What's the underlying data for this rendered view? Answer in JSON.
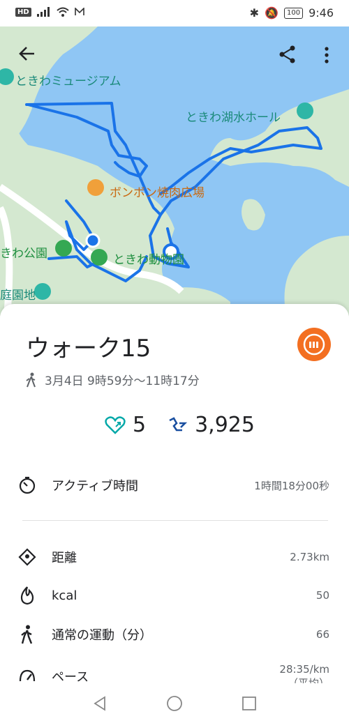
{
  "status_bar": {
    "network_badge": "HD",
    "time": "9:46",
    "battery": "100"
  },
  "map": {
    "labels": {
      "museum": "ときわミュージアム",
      "lake_hall": "ときわ湖水ホール",
      "bbq": "ボンボン焼肉広場",
      "park": "きわ公園",
      "zoo": "ときわ動物園",
      "garden": "庭園地"
    },
    "colors": {
      "water": "#8fc6f4",
      "land": "#d4e8d0",
      "route": "#1a73e8"
    }
  },
  "activity": {
    "title": "ウォーク15",
    "datetime": "3月4日 9時59分〜11時17分",
    "heart_points": "5",
    "steps": "3,925",
    "rows": [
      {
        "label": "アクティブ時間",
        "value": "1時間18分00秒",
        "icon": "timer-icon"
      },
      {
        "label": "距離",
        "value": "2.73km",
        "icon": "location-diamond-icon"
      },
      {
        "label": "kcal",
        "value": "50",
        "icon": "fire-icon"
      },
      {
        "label": "通常の運動（分）",
        "value": "66",
        "icon": "walk-icon"
      },
      {
        "label": "ペース",
        "value": "28:35/km",
        "icon": "gauge-icon"
      }
    ],
    "pace_note": "（平均）"
  },
  "accent_colors": {
    "heart": "#00a8a8",
    "steps": "#1a4fa0",
    "mi_brand": "#f36f21"
  }
}
